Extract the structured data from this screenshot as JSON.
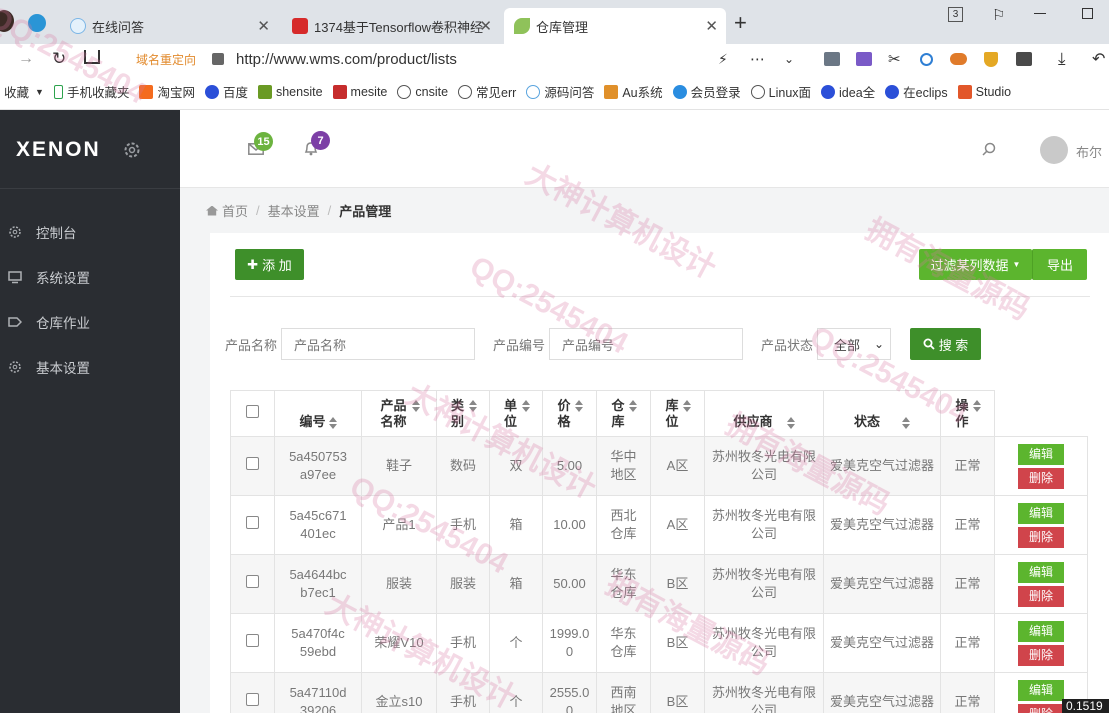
{
  "browser": {
    "tabs": [
      {
        "title": "在线问答"
      },
      {
        "title": "1374基于Tensorflow卷积神经"
      },
      {
        "title": "仓库管理"
      }
    ],
    "window_counter": "3",
    "domain_redirect": "域名重定向",
    "url": "http://www.wms.com/product/lists",
    "bookmarks": [
      "收藏",
      "手机收藏夹",
      "淘宝网",
      "百度",
      "shensite",
      "mesite",
      "cnsite",
      "常见err",
      "源码问答",
      "Au系统",
      "会员登录",
      "Linux面",
      "idea全",
      "在eclips",
      "Studio"
    ]
  },
  "app": {
    "logo": "XENON",
    "sidebar": [
      {
        "label": "控制台",
        "icon": "gear-icon"
      },
      {
        "label": "系统设置",
        "icon": "monitor-icon"
      },
      {
        "label": "仓库作业",
        "icon": "tag-icon"
      },
      {
        "label": "基本设置",
        "icon": "gear-icon"
      }
    ],
    "header": {
      "mail_count": "15",
      "bell_count": "7",
      "username": "布尔"
    },
    "breadcrumb": {
      "home": "首页",
      "section": "基本设置",
      "current": "产品管理"
    },
    "toolbar": {
      "add_label": "添 加",
      "filter_label": "过滤某列数据",
      "export_label": "导出"
    },
    "search": {
      "name_label": "产品名称",
      "name_placeholder": "产品名称",
      "code_label": "产品编号",
      "code_placeholder": "产品编号",
      "status_label": "产品状态",
      "status_value": "全部",
      "search_label": "搜 索"
    },
    "table": {
      "headers": [
        "编号",
        "产品名称",
        "类别",
        "单位",
        "价格",
        "仓库",
        "库位",
        "供应商",
        "状态",
        "操作"
      ],
      "edit_label": "编辑",
      "delete_label": "删除",
      "rows": [
        {
          "id": "5a450753a97ee",
          "name": "鞋子",
          "category": "数码",
          "unit": "双",
          "price": "5.00",
          "warehouse": "华中地区",
          "location": "A区",
          "supplier": "苏州牧冬光电有限公司",
          "product": "爱美克空气过滤器",
          "status": "正常"
        },
        {
          "id": "5a45c671401ec",
          "name": "产品1",
          "category": "手机",
          "unit": "箱",
          "price": "10.00",
          "warehouse": "西北仓库",
          "location": "A区",
          "supplier": "苏州牧冬光电有限公司",
          "product": "爱美克空气过滤器",
          "status": "正常"
        },
        {
          "id": "5a4644bcb7ec1",
          "name": "服装",
          "category": "服装",
          "unit": "箱",
          "price": "50.00",
          "warehouse": "华东仓库",
          "location": "B区",
          "supplier": "苏州牧冬光电有限公司",
          "product": "爱美克空气过滤器",
          "status": "正常"
        },
        {
          "id": "5a470f4c59ebd",
          "name": "荣耀V10",
          "category": "手机",
          "unit": "个",
          "price": "1999.00",
          "warehouse": "华东仓库",
          "location": "B区",
          "supplier": "苏州牧冬光电有限公司",
          "product": "爱美克空气过滤器",
          "status": "正常"
        },
        {
          "id": "5a47110d39206",
          "name": "金立s10",
          "category": "手机",
          "unit": "个",
          "price": "2555.00",
          "warehouse": "西南地区",
          "location": "B区",
          "supplier": "苏州牧冬光电有限公司",
          "product": "爱美克空气过滤器",
          "status": "正常"
        }
      ]
    },
    "corner_value": "0.1519"
  },
  "watermarks": [
    "QQ:2545404",
    "大神计算机设计",
    "QQ:2545404",
    "拥有海量源码",
    "QQ:2545404",
    "大神计算机设计",
    "拥有海量源码",
    "QQ:2545404",
    "大神计算机设计",
    "拥有海量源码"
  ],
  "colors": {
    "accent": "#5cb52e",
    "danger": "#d0444b",
    "sidebar": "#2a2d32",
    "dark_button": "#3e8f2a"
  }
}
